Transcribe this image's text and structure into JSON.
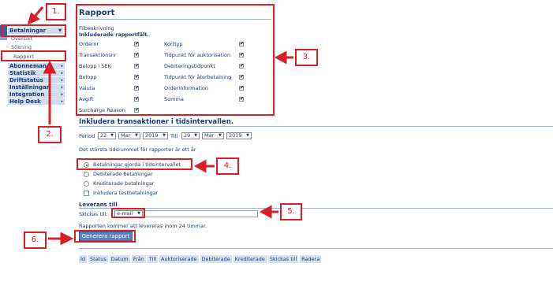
{
  "sidebar": {
    "items": [
      {
        "label": "Betalningar",
        "expanded": true
      },
      {
        "label": "Abonnemang"
      },
      {
        "label": "Statistik"
      },
      {
        "label": "Driftstatus"
      },
      {
        "label": "Inställningar"
      },
      {
        "label": "Integration"
      },
      {
        "label": "Help Desk"
      }
    ],
    "subitems": [
      "Översikt",
      "Sökning",
      "Rapport"
    ],
    "active_subitem": "Rapport"
  },
  "report": {
    "title": "Rapport",
    "file_description_label": "Filbeskrivning",
    "fields_heading": "Inkluderade rapportfält.",
    "fields_left": [
      "Ordernr",
      "Transaktionsnr",
      "Belopp i SEK",
      "Belopp",
      "Valuta",
      "Avgift",
      "Surcharge Reason"
    ],
    "fields_right": [
      "Korttyp",
      "Tidpunkt för auktorisation",
      "Debiteringstidpunkt",
      "Tidpunkt för återbetalning",
      "Orderinformation",
      "Summa"
    ],
    "checked_mark": "✔"
  },
  "period": {
    "heading": "Inkludera transaktioner i tidsintervallen.",
    "label": "Period",
    "from_day": "22",
    "from_month": "Mar",
    "from_year": "2019",
    "to_label": "Till",
    "to_day": "29",
    "to_month": "Mar",
    "to_year": "2019",
    "note": "Det största tidsrummet för rapporter är ett år"
  },
  "options": [
    {
      "label": "Betalningar gjorda i tidsintervallet",
      "type": "radio",
      "selected": true
    },
    {
      "label": "Debiterade betalningar",
      "type": "radio",
      "selected": false
    },
    {
      "label": "Krediterade betalningar",
      "type": "radio",
      "selected": false
    },
    {
      "label": "Inkludera testbetalningar",
      "type": "checkbox",
      "selected": false
    }
  ],
  "delivery": {
    "heading": "Leverans till",
    "send_label": "Skickas till:",
    "method": "e-mail",
    "email_value": "",
    "note": "Rapporten kommer att levereras inom 24 timmar.",
    "generate_button": "Generera rapport"
  },
  "table": {
    "columns": [
      "Id",
      "Status",
      "Datum",
      "Från",
      "Till",
      "Auktoriserade",
      "Debiterade",
      "Krediterade",
      "Skickas till",
      "Radera"
    ]
  },
  "annotations": [
    "1.",
    "2.",
    "3.",
    "4.",
    "5.",
    "6."
  ],
  "colors": {
    "annotation_red": "#d91f26",
    "nav_blue": "#3a5fa0",
    "text_navy": "#1c3c73"
  }
}
